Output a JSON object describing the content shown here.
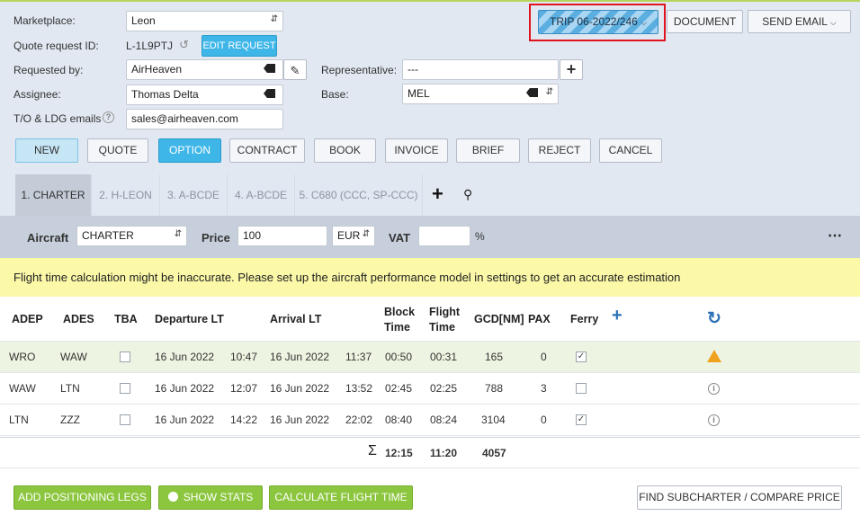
{
  "form": {
    "marketplace_label": "Marketplace:",
    "marketplace_value": "Leon",
    "quote_request_id_label": "Quote request ID:",
    "quote_request_id_value": "L-1L9PTJ",
    "edit_request_label": "EDIT REQUEST",
    "requested_by_label": "Requested by:",
    "requested_by_value": "AirHeaven",
    "representative_label": "Representative:",
    "representative_value": "---",
    "assignee_label": "Assignee:",
    "assignee_value": "Thomas Delta",
    "base_label": "Base:",
    "base_value": "MEL",
    "emails_label": "T/O & LDG emails",
    "emails_value": "sales@airheaven.com"
  },
  "top_buttons": {
    "trip_label": "TRIP 06-2022/246",
    "document_label": "DOCUMENT",
    "send_email_label": "SEND EMAIL"
  },
  "status_buttons": [
    "NEW",
    "QUOTE",
    "OPTION",
    "CONTRACT",
    "BOOK",
    "INVOICE",
    "BRIEF",
    "REJECT",
    "CANCEL"
  ],
  "tabs": [
    "1. CHARTER",
    "2. H-LEON",
    "3. A-BCDE",
    "4. A-BCDE",
    "5. C680 (CCC, SP-CCC)"
  ],
  "aircraft_bar": {
    "aircraft_label": "Aircraft",
    "aircraft_value": "CHARTER",
    "price_label": "Price",
    "price_value": "100",
    "currency_value": "EUR",
    "vat_label": "VAT",
    "vat_value": "",
    "percent": "%"
  },
  "warning": "Flight time calculation might be inaccurate. Please set up the aircraft performance model in settings to get an accurate estimation",
  "table": {
    "headers": {
      "adep": "ADEP",
      "ades": "ADES",
      "tba": "TBA",
      "departure": "Departure LT",
      "arrival": "Arrival LT",
      "block_time_1": "Block",
      "block_time_2": "Time",
      "flight_time_1": "Flight",
      "flight_time_2": "Time",
      "gcd": "GCD[NM]",
      "pax": "PAX",
      "ferry": "Ferry"
    },
    "rows": [
      {
        "adep": "WRO",
        "ades": "WAW",
        "dep_date": "16 Jun 2022",
        "dep_time": "10:47",
        "arr_date": "16 Jun 2022",
        "arr_time": "11:37",
        "block": "00:50",
        "flight": "00:31",
        "gcd": "165",
        "pax": "0"
      },
      {
        "adep": "WAW",
        "ades": "LTN",
        "dep_date": "16 Jun 2022",
        "dep_time": "12:07",
        "arr_date": "16 Jun 2022",
        "arr_time": "13:52",
        "block": "02:45",
        "flight": "02:25",
        "gcd": "788",
        "pax": "3"
      },
      {
        "adep": "LTN",
        "ades": "ZZZ",
        "dep_date": "16 Jun 2022",
        "dep_time": "14:22",
        "arr_date": "16 Jun 2022",
        "arr_time": "22:02",
        "block": "08:40",
        "flight": "08:24",
        "gcd": "3104",
        "pax": "0"
      }
    ],
    "totals": {
      "sigma": "Σ",
      "block": "12:15",
      "flight": "11:20",
      "gcd": "4057"
    }
  },
  "bottom_buttons": {
    "add_positioning": "ADD POSITIONING LEGS",
    "show_stats": "SHOW STATS",
    "calculate": "CALCULATE FLIGHT TIME",
    "find_subcharter": "FIND SUBCHARTER / COMPARE PRICE"
  },
  "colors": {
    "accent_blue": "#3fb6e8",
    "green": "#8cc63f",
    "highlight_red": "#e0141e",
    "warning_yellow": "#fbf8a8"
  }
}
